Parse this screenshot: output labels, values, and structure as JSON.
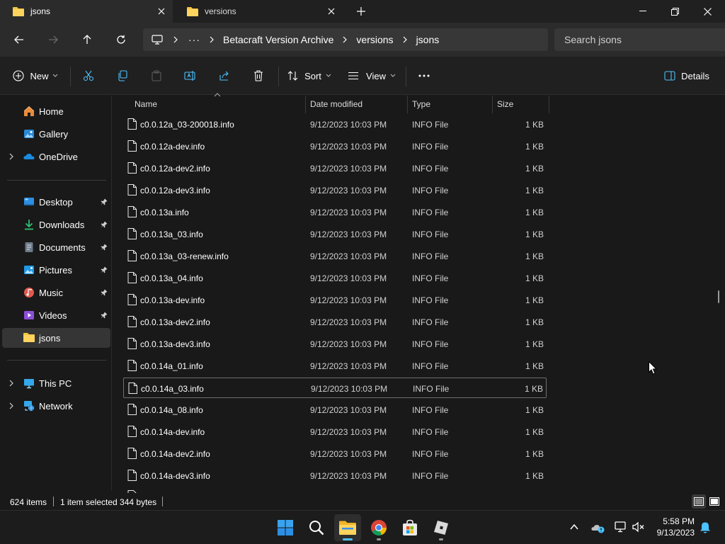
{
  "tabs": [
    {
      "label": "jsons"
    },
    {
      "label": "versions"
    }
  ],
  "breadcrumb": [
    "Betacraft Version Archive",
    "versions",
    "jsons"
  ],
  "search": {
    "placeholder": "Search jsons"
  },
  "toolbar": {
    "new_label": "New",
    "sort_label": "Sort",
    "view_label": "View",
    "details_label": "Details"
  },
  "sidebar": {
    "home": "Home",
    "gallery": "Gallery",
    "onedrive": "OneDrive",
    "desktop": "Desktop",
    "downloads": "Downloads",
    "documents": "Documents",
    "pictures": "Pictures",
    "music": "Music",
    "videos": "Videos",
    "jsons": "jsons",
    "thispc": "This PC",
    "network": "Network"
  },
  "columns": {
    "name": "Name",
    "date": "Date modified",
    "type": "Type",
    "size": "Size"
  },
  "files": [
    {
      "name": "c0.0.12a_03-200018.info",
      "date": "9/12/2023 10:03 PM",
      "type": "INFO File",
      "size": "1 KB"
    },
    {
      "name": "c0.0.12a-dev.info",
      "date": "9/12/2023 10:03 PM",
      "type": "INFO File",
      "size": "1 KB"
    },
    {
      "name": "c0.0.12a-dev2.info",
      "date": "9/12/2023 10:03 PM",
      "type": "INFO File",
      "size": "1 KB"
    },
    {
      "name": "c0.0.12a-dev3.info",
      "date": "9/12/2023 10:03 PM",
      "type": "INFO File",
      "size": "1 KB"
    },
    {
      "name": "c0.0.13a.info",
      "date": "9/12/2023 10:03 PM",
      "type": "INFO File",
      "size": "1 KB"
    },
    {
      "name": "c0.0.13a_03.info",
      "date": "9/12/2023 10:03 PM",
      "type": "INFO File",
      "size": "1 KB"
    },
    {
      "name": "c0.0.13a_03-renew.info",
      "date": "9/12/2023 10:03 PM",
      "type": "INFO File",
      "size": "1 KB"
    },
    {
      "name": "c0.0.13a_04.info",
      "date": "9/12/2023 10:03 PM",
      "type": "INFO File",
      "size": "1 KB"
    },
    {
      "name": "c0.0.13a-dev.info",
      "date": "9/12/2023 10:03 PM",
      "type": "INFO File",
      "size": "1 KB"
    },
    {
      "name": "c0.0.13a-dev2.info",
      "date": "9/12/2023 10:03 PM",
      "type": "INFO File",
      "size": "1 KB"
    },
    {
      "name": "c0.0.13a-dev3.info",
      "date": "9/12/2023 10:03 PM",
      "type": "INFO File",
      "size": "1 KB"
    },
    {
      "name": "c0.0.14a_01.info",
      "date": "9/12/2023 10:03 PM",
      "type": "INFO File",
      "size": "1 KB"
    },
    {
      "name": "c0.0.14a_03.info",
      "date": "9/12/2023 10:03 PM",
      "type": "INFO File",
      "size": "1 KB"
    },
    {
      "name": "c0.0.14a_08.info",
      "date": "9/12/2023 10:03 PM",
      "type": "INFO File",
      "size": "1 KB"
    },
    {
      "name": "c0.0.14a-dev.info",
      "date": "9/12/2023 10:03 PM",
      "type": "INFO File",
      "size": "1 KB"
    },
    {
      "name": "c0.0.14a-dev2.info",
      "date": "9/12/2023 10:03 PM",
      "type": "INFO File",
      "size": "1 KB"
    },
    {
      "name": "c0.0.14a-dev3.info",
      "date": "9/12/2023 10:03 PM",
      "type": "INFO File",
      "size": "1 KB"
    }
  ],
  "selected_file": "c0.0.14a_03.info",
  "status": {
    "count": "624 items",
    "selection": "1 item selected 344 bytes"
  },
  "clock": {
    "time": "5:58 PM",
    "date": "9/13/2023"
  },
  "colors": {
    "folder": "#f4c542",
    "accent": "#4cc2ff",
    "selection_border": "#6e6e6e"
  },
  "taskbar_icons": [
    "windows-start-icon",
    "search-icon",
    "file-explorer-icon",
    "chrome-icon",
    "microsoft-store-icon",
    "roblox-icon"
  ]
}
